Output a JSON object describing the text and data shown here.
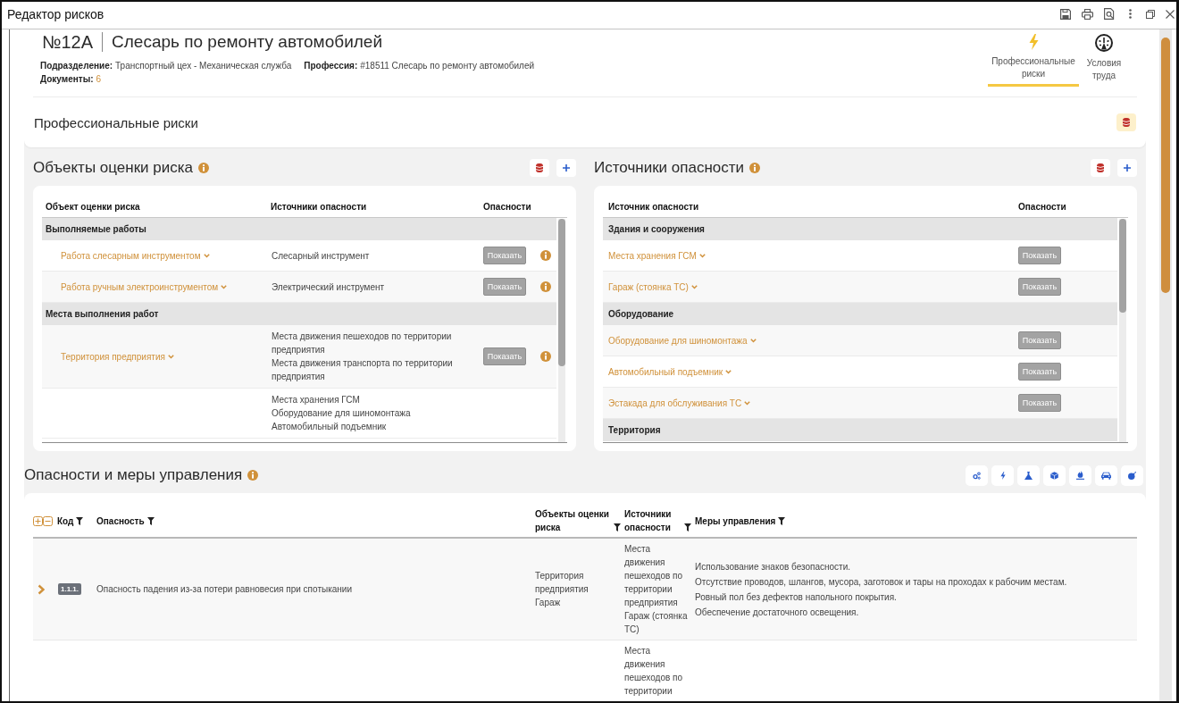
{
  "window": {
    "title": "Редактор рисков"
  },
  "header": {
    "number": "№12A",
    "title": "Слесарь по ремонту автомобилей",
    "field_lines": [
      [
        {
          "label": "Подразделение:",
          "value": "Транспортный цех - Механическая служба",
          "kind": "text"
        },
        {
          "label": "Профессия:",
          "value": "#18511 Слесарь по ремонту автомобилей",
          "kind": "text"
        }
      ],
      [
        {
          "label": "Документы:",
          "value": "6",
          "kind": "link"
        }
      ]
    ],
    "tabs": [
      {
        "label": "Профессиональные риски",
        "kind": "risks",
        "selected": true
      },
      {
        "label": "Условия труда",
        "kind": "conditions",
        "selected": false
      }
    ],
    "section_title": "Профессиональные риски"
  },
  "objects_panel": {
    "title": "Объекты оценки риска",
    "columns": [
      "Объект оценки риска",
      "Источники опасности",
      "Опасности"
    ],
    "rows": [
      {
        "kind": "group",
        "label": "Выполняемые работы"
      },
      {
        "kind": "item",
        "name": "Работа слесарным инструментом",
        "sources": [
          "Слесарный инструмент"
        ],
        "action": "Показать"
      },
      {
        "kind": "item",
        "name": "Работа ручным электроинструментом",
        "sources": [
          "Электрический инструмент"
        ],
        "action": "Показать"
      },
      {
        "kind": "group",
        "label": "Места выполнения работ"
      },
      {
        "kind": "item",
        "name": "Территория предприятия",
        "sources": [
          "Места движения пешеходов по территории предприятия",
          "Места движения транспорта по территории предприятия"
        ],
        "action": "Показать"
      },
      {
        "kind": "item",
        "sources": [
          "Места хранения ГСМ",
          "Оборудование для шиномонтажа",
          "Автомобильный подъемник"
        ]
      }
    ]
  },
  "sources_panel": {
    "title": "Источники опасности",
    "columns": [
      "Источник опасности",
      "Опасности"
    ],
    "rows": [
      {
        "kind": "group",
        "label": "Здания и сооружения"
      },
      {
        "kind": "item",
        "name": "Места хранения ГСМ",
        "action": "Показать"
      },
      {
        "kind": "item",
        "name": "Гараж (стоянка ТС)",
        "action": "Показать"
      },
      {
        "kind": "group",
        "label": "Оборудование"
      },
      {
        "kind": "item",
        "name": "Оборудование для шиномонтажа",
        "action": "Показать"
      },
      {
        "kind": "item",
        "name": "Автомобильный подъемник",
        "action": "Показать"
      },
      {
        "kind": "item",
        "name": "Эстакада для обслуживания ТС",
        "action": "Показать"
      },
      {
        "kind": "group",
        "label": "Территория"
      }
    ]
  },
  "hazards": {
    "title": "Опасности и меры управления",
    "columns": [
      {
        "label": "Код",
        "filter": true
      },
      {
        "label": "Опасность",
        "filter": true
      },
      {
        "label": "Объекты оценки риска",
        "filter": true
      },
      {
        "label": "Источники опасности",
        "filter": true
      },
      {
        "label": "Меры управления",
        "filter": true
      }
    ],
    "rows": [
      {
        "expanded": false,
        "code": "1.1.1.",
        "hazard": "Опасность падения из-за потери равновесия при спотыкании",
        "objects": [
          "Территория предприятия",
          "Гараж"
        ],
        "sources": [
          "Места движения пешеходов по территории предприятия",
          "Гараж (стоянка ТС)"
        ],
        "measures": [
          "Использование знаков безопасности.",
          "Отсутствие проводов, шлангов, мусора, заготовок и тары на проходах к рабочим местам.",
          "Ровный пол без дефектов напольного покрытия.",
          "Обеспечение достаточного освещения."
        ]
      },
      {
        "sources": [
          "Места движения пешеходов по территории"
        ]
      }
    ]
  }
}
